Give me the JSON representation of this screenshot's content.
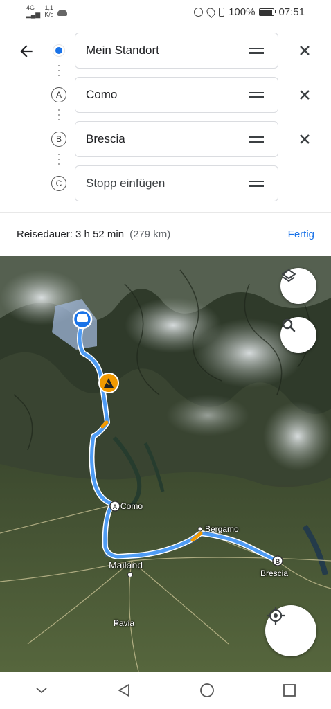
{
  "status_bar": {
    "signal": "4G",
    "speed": "1,1",
    "speed_unit": "K/s",
    "battery": "100%",
    "battery_level": 1.0,
    "time": "07:51"
  },
  "route": {
    "origin": "Mein Standort",
    "stop_a": {
      "letter": "A",
      "value": "Como"
    },
    "stop_b": {
      "letter": "B",
      "value": "Brescia"
    },
    "stop_c": {
      "letter": "C",
      "placeholder": "Stopp einfügen"
    }
  },
  "summary": {
    "duration": "Reisedauer: 3 h 52 min",
    "distance": "(279 km)",
    "done_label": "Fertig"
  },
  "map": {
    "labels": {
      "como": "Como",
      "bergamo": "Bergamo",
      "mailand": "Mailand",
      "brescia": "Brescia",
      "pavia": "Pavia"
    },
    "pin_a": "A",
    "pin_b": "B",
    "route_color": "#4f9cf5",
    "alt_route_color": "#8ab4f8",
    "traffic_color": "#f29900",
    "icons": [
      "car-icon",
      "construction-icon",
      "layers-icon",
      "search-icon",
      "my-location-icon"
    ]
  },
  "nav": {
    "icons": [
      "chevron-down-icon",
      "back-triangle-icon",
      "home-circle-icon",
      "recents-square-icon"
    ]
  }
}
